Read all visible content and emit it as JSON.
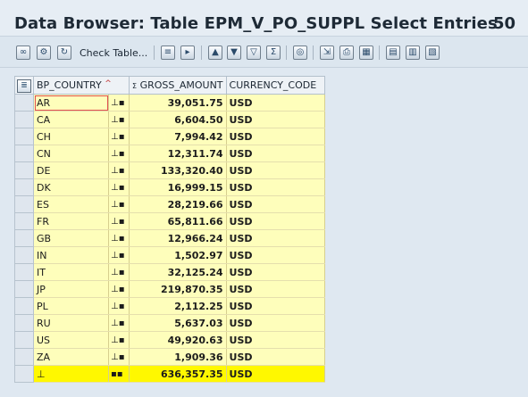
{
  "window": {
    "title": "Data Browser: Table EPM_V_PO_SUPPL Select Entries",
    "entries_count": "50"
  },
  "toolbar": {
    "check_table_label": "Check Table...",
    "icons": [
      "glasses-icon",
      "refresh-settings-icon",
      "refresh-icon",
      "details-icon",
      "select-icon",
      "sort-ascending-icon",
      "sort-descending-icon",
      "filter-icon",
      "sum-icon",
      "subtotal-icon",
      "export-icon",
      "print-icon",
      "view-icon",
      "layout-icon",
      "change-layout-icon",
      "save-layout-icon"
    ]
  },
  "grid": {
    "columns": [
      "BP_COUNTRY",
      "GROSS_AMOUNT",
      "CURRENCY_CODE"
    ],
    "rows": [
      {
        "country": "AR",
        "amount": "39,051.75",
        "currency": "USD"
      },
      {
        "country": "CA",
        "amount": "6,604.50",
        "currency": "USD"
      },
      {
        "country": "CH",
        "amount": "7,994.42",
        "currency": "USD"
      },
      {
        "country": "CN",
        "amount": "12,311.74",
        "currency": "USD"
      },
      {
        "country": "DE",
        "amount": "133,320.40",
        "currency": "USD"
      },
      {
        "country": "DK",
        "amount": "16,999.15",
        "currency": "USD"
      },
      {
        "country": "ES",
        "amount": "28,219.66",
        "currency": "USD"
      },
      {
        "country": "FR",
        "amount": "65,811.66",
        "currency": "USD"
      },
      {
        "country": "GB",
        "amount": "12,966.24",
        "currency": "USD"
      },
      {
        "country": "IN",
        "amount": "1,502.97",
        "currency": "USD"
      },
      {
        "country": "IT",
        "amount": "32,125.24",
        "currency": "USD"
      },
      {
        "country": "JP",
        "amount": "219,870.35",
        "currency": "USD"
      },
      {
        "country": "PL",
        "amount": "2,112.25",
        "currency": "USD"
      },
      {
        "country": "RU",
        "amount": "5,637.03",
        "currency": "USD"
      },
      {
        "country": "US",
        "amount": "49,920.63",
        "currency": "USD"
      },
      {
        "country": "ZA",
        "amount": "1,909.36",
        "currency": "USD"
      }
    ],
    "total": {
      "amount": "636,357.35",
      "currency": "USD"
    }
  },
  "colors": {
    "row_yellow": "#fefebb",
    "total_yellow": "#fff800",
    "background": "#dfe8f1"
  }
}
